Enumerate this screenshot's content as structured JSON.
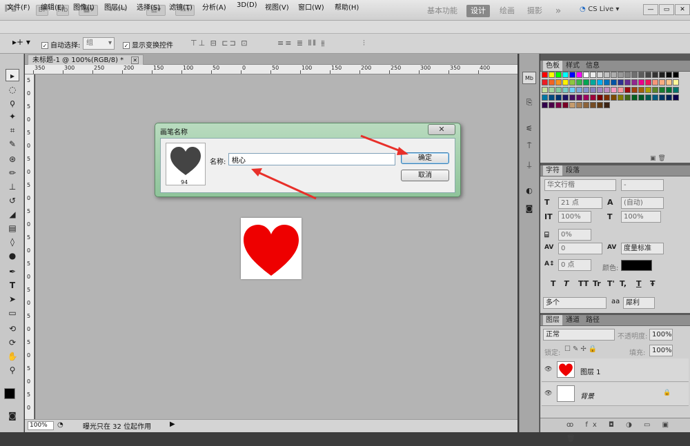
{
  "app": {
    "logo": "Ps",
    "toolbar_icons": [
      "Br",
      "Mb"
    ],
    "zoom": "100%",
    "workspaces": [
      "基本功能",
      "设计",
      "绘画",
      "摄影"
    ],
    "workspace_more": "»",
    "cslive": "CS Live ▾",
    "win_controls": [
      "—",
      "▭",
      "✕"
    ]
  },
  "menu": [
    "文件(F)",
    "编辑(E)",
    "图像(I)",
    "图层(L)",
    "选择(S)",
    "滤镜(T)",
    "分析(A)",
    "3D(D)",
    "视图(V)",
    "窗口(W)",
    "帮助(H)"
  ],
  "options": {
    "auto_select_label": "自动选择:",
    "auto_select_value": "组",
    "transform_label": "显示变换控件"
  },
  "document": {
    "tab_title": "未标题-1 @ 100%(RGB/8) *",
    "tab_close": "✕",
    "ruler_h": [
      "350",
      "300",
      "250",
      "200",
      "150",
      "100",
      "50",
      "0",
      "50",
      "100",
      "150",
      "200",
      "250",
      "300",
      "350",
      "400"
    ],
    "ruler_v": [
      "5",
      "0",
      "5",
      "0",
      "5",
      "0",
      "5",
      "0",
      "5",
      "0",
      "5",
      "0",
      "5",
      "0",
      "5",
      "0",
      "5",
      "0",
      "5",
      "0",
      "5",
      "0",
      "5",
      "0",
      "5",
      "0"
    ],
    "zoom_value": "100%",
    "status_text": "曝光只在 32 位起作用"
  },
  "dialog": {
    "title": "画笔名称",
    "close": "✕",
    "brush_size": "94",
    "name_label": "名称:",
    "name_value": "桃心",
    "ok_label": "确定",
    "cancel_label": "取消"
  },
  "panels": {
    "color_tabs": [
      "色板",
      "样式",
      "信息"
    ],
    "char_tabs": [
      "字符",
      "段落"
    ],
    "font_family": "华文行楷",
    "font_style": "-",
    "font_size": "21 点",
    "leading": "(自动)",
    "vscale": "100%",
    "hscale": "100%",
    "baseline": "0%",
    "kerning": "0",
    "tracking": "度量标准",
    "baseline_shift": "0 点",
    "color_label": "颜色:",
    "text_buttons": [
      "T",
      "T",
      "TT",
      "Tr",
      "T'",
      "T,",
      "T",
      "Ŧ"
    ],
    "language": "多个",
    "aa_label": "aa",
    "antialias": "犀利",
    "layer_tabs": [
      "图层",
      "通道",
      "路径"
    ],
    "blend_mode": "正常",
    "opacity_label": "不透明度:",
    "opacity": "100%",
    "lock_label": "锁定:",
    "fill_label": "填充:",
    "fill": "100%",
    "layers": [
      "图层 1",
      "背景"
    ],
    "layer_footer": "ꝏ fx ◘ ◑ ▭ ▣ 🗑"
  },
  "colors": {
    "heart": "#ee0000",
    "dialog_green": "#9ccba5",
    "arrow": "#e8302a"
  }
}
